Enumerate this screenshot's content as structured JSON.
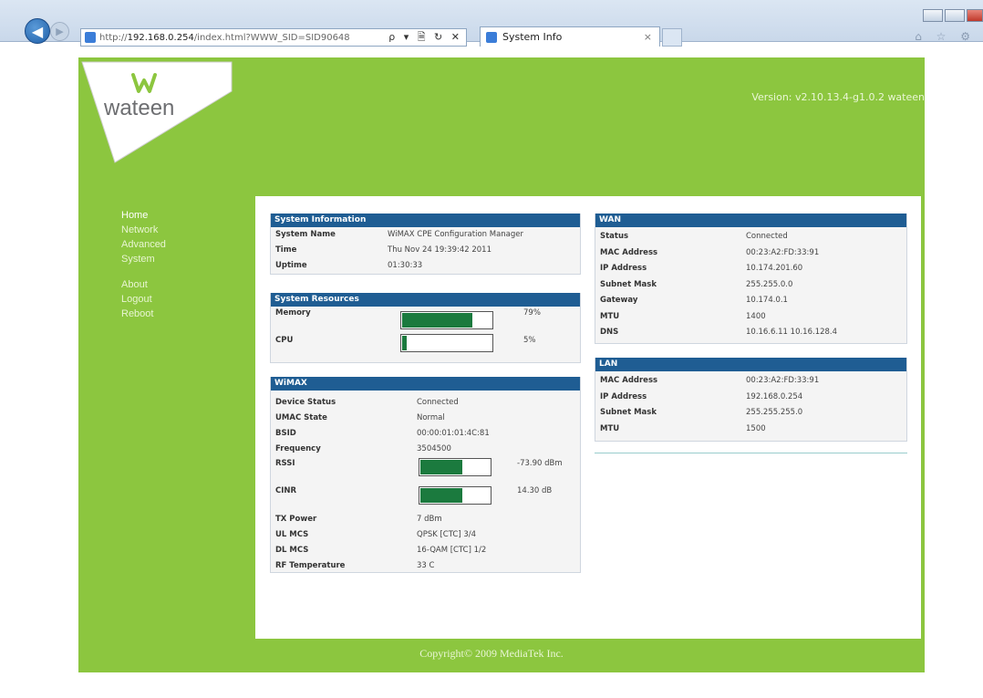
{
  "browser": {
    "url_prefix": "http://",
    "url_host": "192.168.0.254",
    "url_rest": "/index.html?WWW_SID=SID90648",
    "address_tools": "ρ ▾ 🗎 ↻ ✕",
    "tab_title": "System Info",
    "tab_close": "×",
    "right_icons": "⌂ ☆ ⚙"
  },
  "header": {
    "version": "Version: v2.10.13.4-g1.0.2 wateen",
    "logo_text": "wateen"
  },
  "nav": {
    "home": "Home",
    "network": "Network",
    "advanced": "Advanced",
    "system": "System",
    "about": "About",
    "logout": "Logout",
    "reboot": "Reboot"
  },
  "system_information": {
    "title": "System Information",
    "rows": [
      {
        "label": "System Name",
        "value": "WiMAX CPE Configuration Manager"
      },
      {
        "label": "Time",
        "value": "Thu Nov 24 19:39:42 2011"
      },
      {
        "label": "Uptime",
        "value": "01:30:33"
      }
    ]
  },
  "system_resources": {
    "title": "System Resources",
    "memory_label": "Memory",
    "memory_value": "79%",
    "memory_fraction": 0.79,
    "cpu_label": "CPU",
    "cpu_value": "5%",
    "cpu_fraction": 0.05
  },
  "wimax": {
    "title": "WiMAX",
    "rows_top": [
      {
        "label": "Device Status",
        "value": "Connected"
      },
      {
        "label": "UMAC State",
        "value": "Normal"
      },
      {
        "label": "BSID",
        "value": "00:00:01:01:4C:81"
      },
      {
        "label": "Frequency",
        "value": "3504500"
      }
    ],
    "rssi_label": "RSSI",
    "rssi_value": "-73.90 dBm",
    "rssi_fraction": 0.6,
    "cinr_label": "CINR",
    "cinr_value": "14.30 dB",
    "cinr_fraction": 0.6,
    "rows_bottom": [
      {
        "label": "TX Power",
        "value": "7 dBm"
      },
      {
        "label": "UL MCS",
        "value": "QPSK [CTC] 3/4"
      },
      {
        "label": "DL MCS",
        "value": "16-QAM [CTC] 1/2"
      },
      {
        "label": "RF Temperature",
        "value": "33 C"
      }
    ]
  },
  "wan": {
    "title": "WAN",
    "rows": [
      {
        "label": "Status",
        "value": "Connected"
      },
      {
        "label": "MAC Address",
        "value": "00:23:A2:FD:33:91"
      },
      {
        "label": "IP Address",
        "value": "10.174.201.60"
      },
      {
        "label": "Subnet Mask",
        "value": "255.255.0.0"
      },
      {
        "label": "Gateway",
        "value": "10.174.0.1"
      },
      {
        "label": "MTU",
        "value": "1400"
      },
      {
        "label": "DNS",
        "value": "10.16.6.11 10.16.128.4"
      }
    ]
  },
  "lan": {
    "title": "LAN",
    "rows": [
      {
        "label": "MAC Address",
        "value": "00:23:A2:FD:33:91"
      },
      {
        "label": "IP Address",
        "value": "192.168.0.254"
      },
      {
        "label": "Subnet Mask",
        "value": "255.255.255.0"
      },
      {
        "label": "MTU",
        "value": "1500"
      }
    ]
  },
  "footer": {
    "copyright": "Copyright© 2009 MediaTek Inc."
  },
  "colors": {
    "brand_green": "#8cc63f",
    "panel_header": "#1f5d93",
    "bar_fill": "#1b7a3e"
  }
}
